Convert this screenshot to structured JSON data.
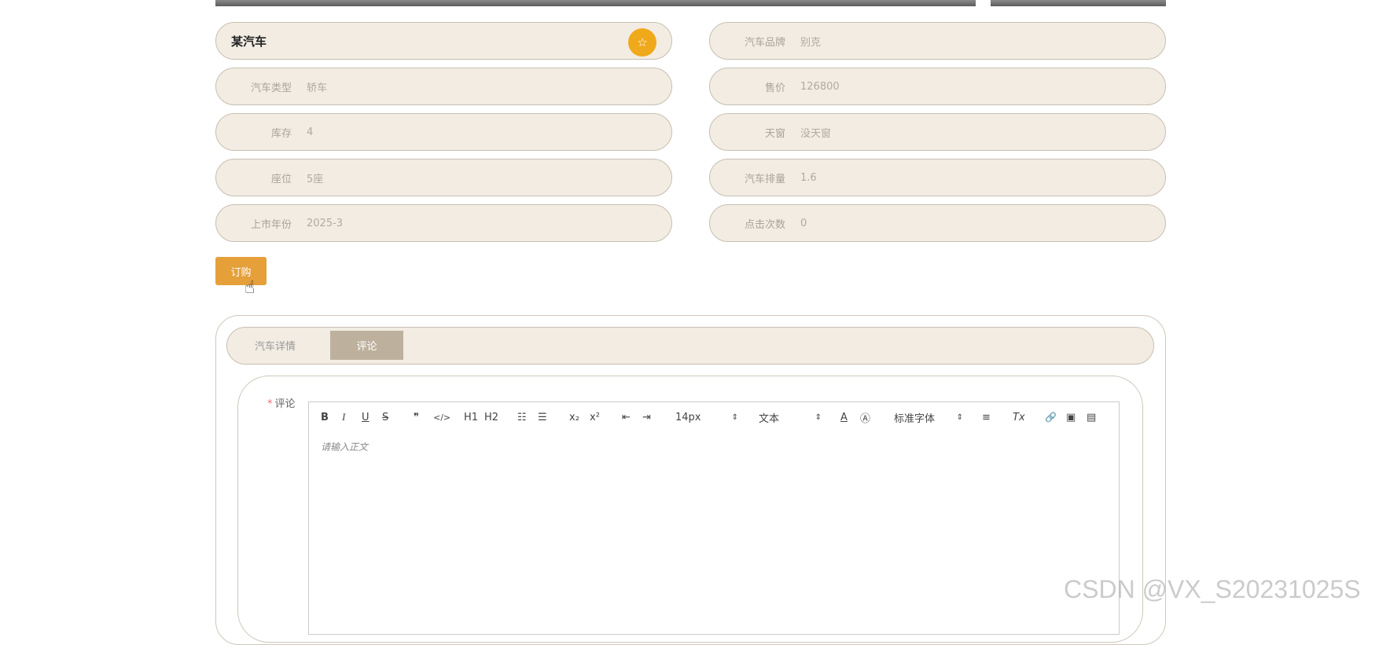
{
  "product": {
    "title": "某汽车",
    "fav_icon": "star-icon"
  },
  "fields": [
    {
      "label": "汽车品牌",
      "value": "别克"
    },
    {
      "label": "汽车类型",
      "value": "轿车"
    },
    {
      "label": "售价",
      "value": "126800"
    },
    {
      "label": "库存",
      "value": "4"
    },
    {
      "label": "天窗",
      "value": "没天窗"
    },
    {
      "label": "座位",
      "value": "5座"
    },
    {
      "label": "汽车排量",
      "value": "1.6"
    },
    {
      "label": "上市年份",
      "value": "2025-3"
    },
    {
      "label": "点击次数",
      "value": "0"
    }
  ],
  "order_button": "订购",
  "tabs": [
    "汽车详情",
    "评论"
  ],
  "comment": {
    "label": "评论",
    "required_mark": "*",
    "placeholder": "请输入正文",
    "toolbar": {
      "bold": "B",
      "italic": "I",
      "underline": "U",
      "strike": "S",
      "quote": "❞",
      "code": "</>",
      "h1": "H1",
      "h2": "H2",
      "ordered_list": "☷",
      "bullet_list": "☰",
      "subscript": "x₂",
      "superscript": "x²",
      "outdent": "⇤",
      "indent": "⇥",
      "size": "14px",
      "header": "文本",
      "font": "标准字体",
      "align": "≡",
      "clean": "Tx",
      "link": "🔗",
      "image": "▣",
      "video": "▤"
    }
  },
  "watermark": "CSDN @VX_S20231025S",
  "colors": {
    "accent": "#e5a03a",
    "pill_bg": "#f2ece2",
    "tab_active": "#bdb19d",
    "fav": "#f0a91a"
  }
}
